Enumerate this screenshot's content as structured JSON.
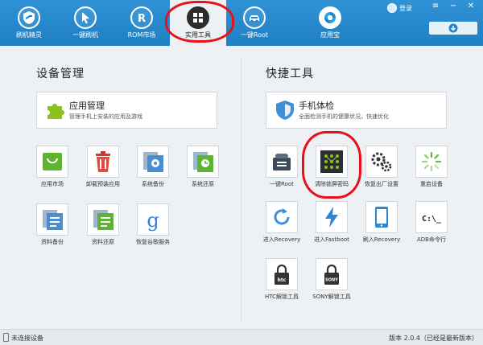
{
  "nav": {
    "items": [
      {
        "label": "刷机精灵",
        "icon": "shield-icon"
      },
      {
        "label": "一键刷机",
        "icon": "cursor-icon"
      },
      {
        "label": "ROM市场",
        "icon": "rom-icon"
      },
      {
        "label": "实用工具",
        "icon": "apps-grid-icon",
        "active": true
      },
      {
        "label": "一键Root",
        "icon": "car-icon"
      },
      {
        "label": "应用宝",
        "icon": "app-store-icon"
      }
    ],
    "login_label": "登录",
    "menu_icon": "≡",
    "minimize_icon": "−",
    "close_icon": "✕"
  },
  "left": {
    "title": "设备管理",
    "feature": {
      "title": "应用管理",
      "desc": "管理手机上安装的应用及游戏"
    },
    "tiles": [
      {
        "label": "应用市场",
        "icon": "shopping-bag-icon"
      },
      {
        "label": "卸载预装应用",
        "icon": "trash-icon"
      },
      {
        "label": "系统备份",
        "icon": "system-backup-icon"
      },
      {
        "label": "系统还原",
        "icon": "system-restore-icon"
      },
      {
        "label": "资料备份",
        "icon": "document-backup-icon"
      },
      {
        "label": "资料还原",
        "icon": "document-restore-icon"
      },
      {
        "label": "恢复谷歌服务",
        "icon": "google-icon"
      }
    ]
  },
  "right": {
    "title": "快捷工具",
    "feature": {
      "title": "手机体检",
      "desc": "全面检测手机的健康状况，快速优化"
    },
    "tiles": [
      {
        "label": "一键Root",
        "icon": "android-root-icon"
      },
      {
        "label": "清除锁屏密码",
        "icon": "pattern-lock-icon"
      },
      {
        "label": "恢复出厂设置",
        "icon": "gears-icon"
      },
      {
        "label": "重启设备",
        "icon": "loading-spinner-icon"
      },
      {
        "label": "进入Recovery",
        "icon": "refresh-icon"
      },
      {
        "label": "进入Fastboot",
        "icon": "lightning-icon"
      },
      {
        "label": "刷入Recovery",
        "icon": "phone-icon"
      },
      {
        "label": "ADB命令行",
        "icon": "terminal-icon"
      },
      {
        "label": "HTC解锁工具",
        "icon": "htc-lock-icon"
      },
      {
        "label": "SONY解锁工具",
        "icon": "sony-lock-icon"
      }
    ],
    "terminal_glyph": "C:\\_"
  },
  "status": {
    "connection": "未连接设备",
    "version": "版本 2.0.4（已经是最新版本）"
  },
  "colors": {
    "brand_blue": "#2384c9",
    "highlight_red": "#e8101a"
  }
}
